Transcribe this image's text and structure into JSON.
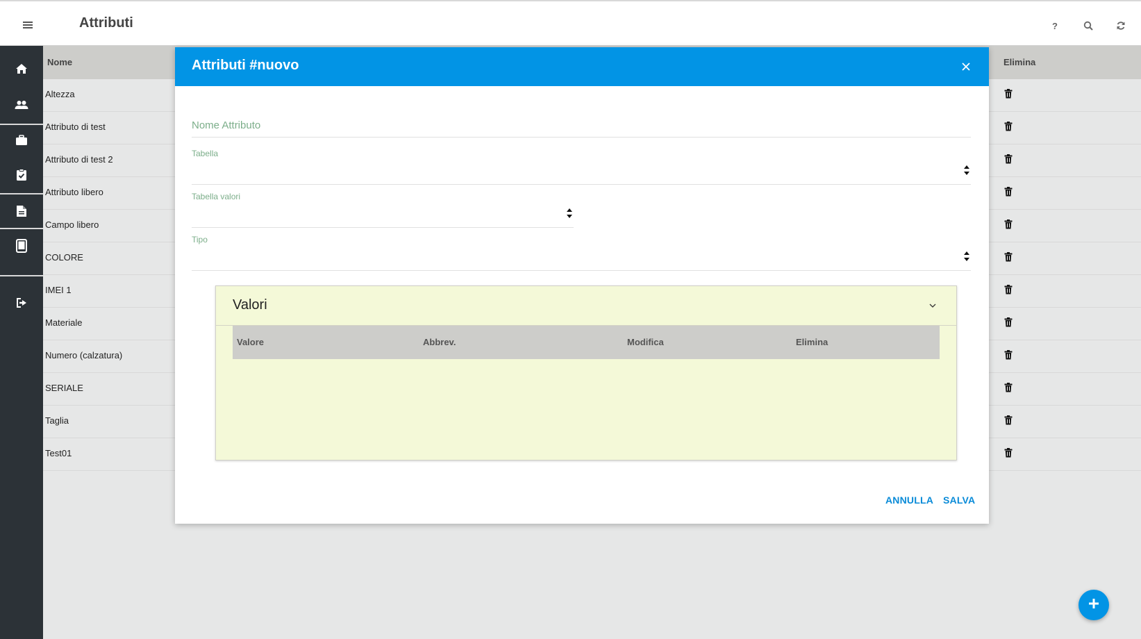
{
  "topbar": {
    "title": "Attributi",
    "icons": [
      "menu-icon",
      "help-icon",
      "search-icon",
      "refresh-icon"
    ],
    "help_label": "?"
  },
  "sidebar": {
    "items": [
      {
        "icon": "home-icon"
      },
      {
        "icon": "users-icon"
      },
      {
        "icon": "briefcase-icon"
      },
      {
        "icon": "clipboard-check-icon"
      },
      {
        "icon": "document-icon"
      },
      {
        "icon": "tablet-icon"
      },
      {
        "icon": "logout-icon"
      }
    ]
  },
  "table": {
    "headers": {
      "name": "Nome",
      "delete": "Elimina"
    },
    "rows": [
      {
        "name": "Altezza"
      },
      {
        "name": "Attributo di test"
      },
      {
        "name": "Attributo di test 2"
      },
      {
        "name": "Attributo libero"
      },
      {
        "name": "Campo libero"
      },
      {
        "name": "COLORE"
      },
      {
        "name": "IMEI 1"
      },
      {
        "name": "Materiale"
      },
      {
        "name": "Numero (calzatura)"
      },
      {
        "name": "SERIALE"
      },
      {
        "name": "Taglia"
      },
      {
        "name": "Test01"
      }
    ]
  },
  "modal": {
    "title": "Attributi #nuovo",
    "nome_placeholder": "Nome Attributo",
    "nome_value": "",
    "tabella_label": "Tabella",
    "tabella_valori_label": "Tabella valori",
    "tipo_label": "Tipo",
    "valori": {
      "title": "Valori",
      "columns": [
        "Valore",
        "Abbrev.",
        "Modifica",
        "Elimina"
      ]
    },
    "cancel_label": "ANNULLA",
    "save_label": "SALVA"
  },
  "colors": {
    "primary": "#0294e5",
    "sidebar": "#2c3237",
    "valori_bg": "#f4f9d8",
    "label_green": "#7cae8a"
  }
}
